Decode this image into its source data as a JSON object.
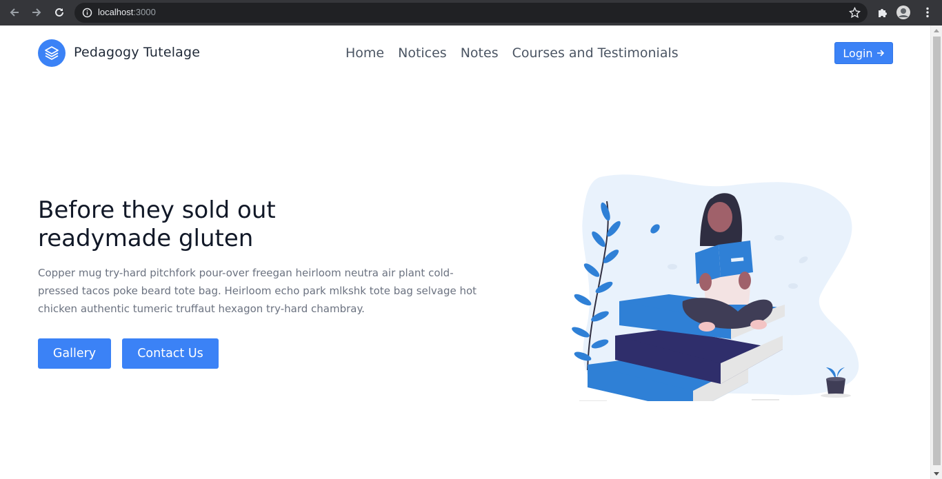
{
  "browser": {
    "url_host": "localhost",
    "url_port": ":3000",
    "icons": [
      "back-arrow-icon",
      "forward-arrow-icon",
      "reload-icon",
      "info-icon",
      "star-icon",
      "puzzle-icon",
      "profile-avatar",
      "menu-dots-icon"
    ]
  },
  "header": {
    "brand": "Pedagogy Tutelage",
    "nav": [
      "Home",
      "Notices",
      "Notes",
      "Courses and Testimonials"
    ],
    "login_label": "Login",
    "login_icon": "arrow-right-icon"
  },
  "hero": {
    "title_line1": "Before they sold out",
    "title_line2": "readymade gluten",
    "body": "Copper mug try-hard pitchfork pour-over freegan heirloom neutra air plant cold-pressed tacos poke beard tote bag. Heirloom echo park mlkshk tote bag selvage hot chicken authentic tumeric truffaut hexagon try-hard chambray.",
    "buttons": [
      "Gallery",
      "Contact Us"
    ]
  },
  "colors": {
    "accent": "#3b82f6",
    "book_blue": "#2f80d6",
    "book_navy": "#2f2e6b",
    "blob": "#e9f2fc"
  }
}
